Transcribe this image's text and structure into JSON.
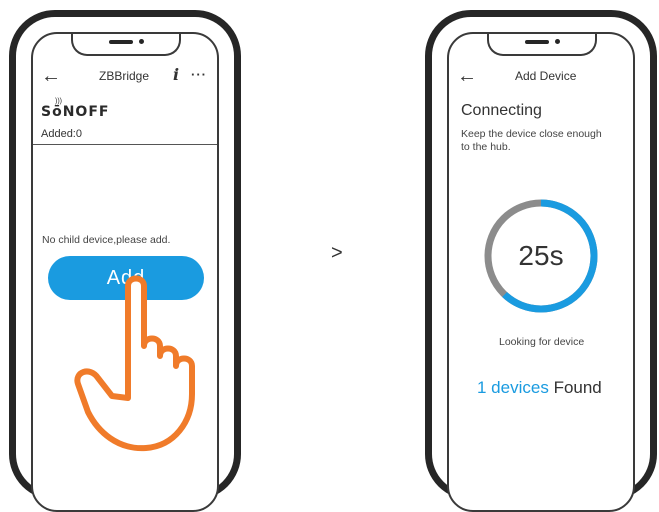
{
  "step_separator": ">",
  "left_screen": {
    "nav": {
      "back_icon": "←",
      "title": "ZBBridge",
      "info_icon": "i",
      "more_icon": "···"
    },
    "brand": "Sōnoff",
    "brand_display": "SōNOFF",
    "added_label": "Added:0",
    "empty_message": "No child device,please add.",
    "add_button": "Add",
    "accent_color": "#1a9be0",
    "hand_color": "#f07b2a"
  },
  "right_screen": {
    "nav": {
      "back_icon": "←",
      "title": "Add Device"
    },
    "heading": "Connecting",
    "hint": "Keep the device close enough to the hub.",
    "timer": "25s",
    "progress_fraction": 0.62,
    "ring_colors": {
      "progress": "#1a9be0",
      "track": "#8c8c8c"
    },
    "looking_text": "Looking for device",
    "found_count": "1 devices",
    "found_word": "Found"
  }
}
